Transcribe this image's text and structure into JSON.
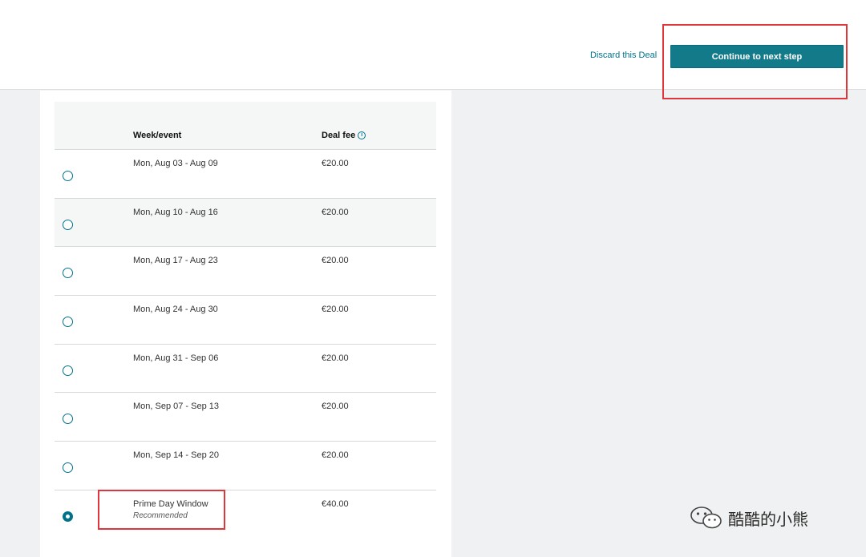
{
  "header": {
    "discard_label": "Discard this Deal",
    "continue_label": "Continue to next step"
  },
  "table": {
    "columns": {
      "week": "Week/event",
      "fee": "Deal fee"
    },
    "rows": [
      {
        "week": "Mon, Aug 03 - Aug 09",
        "fee": "€20.00",
        "selected": false
      },
      {
        "week": "Mon, Aug 10 - Aug 16",
        "fee": "€20.00",
        "selected": false
      },
      {
        "week": "Mon, Aug 17 - Aug 23",
        "fee": "€20.00",
        "selected": false
      },
      {
        "week": "Mon, Aug 24 - Aug 30",
        "fee": "€20.00",
        "selected": false
      },
      {
        "week": "Mon, Aug 31 - Sep 06",
        "fee": "€20.00",
        "selected": false
      },
      {
        "week": "Mon, Sep 07 - Sep 13",
        "fee": "€20.00",
        "selected": false
      },
      {
        "week": "Mon, Sep 14 - Sep 20",
        "fee": "€20.00",
        "selected": false
      },
      {
        "week": "Prime Day Window",
        "sub": "Recommended",
        "fee": "€40.00",
        "selected": true
      }
    ]
  },
  "watermark": {
    "text": "酷酷的小熊",
    "icon": "wechat-icon"
  },
  "colors": {
    "accent": "#137a8a",
    "highlight": "#e0353b"
  }
}
